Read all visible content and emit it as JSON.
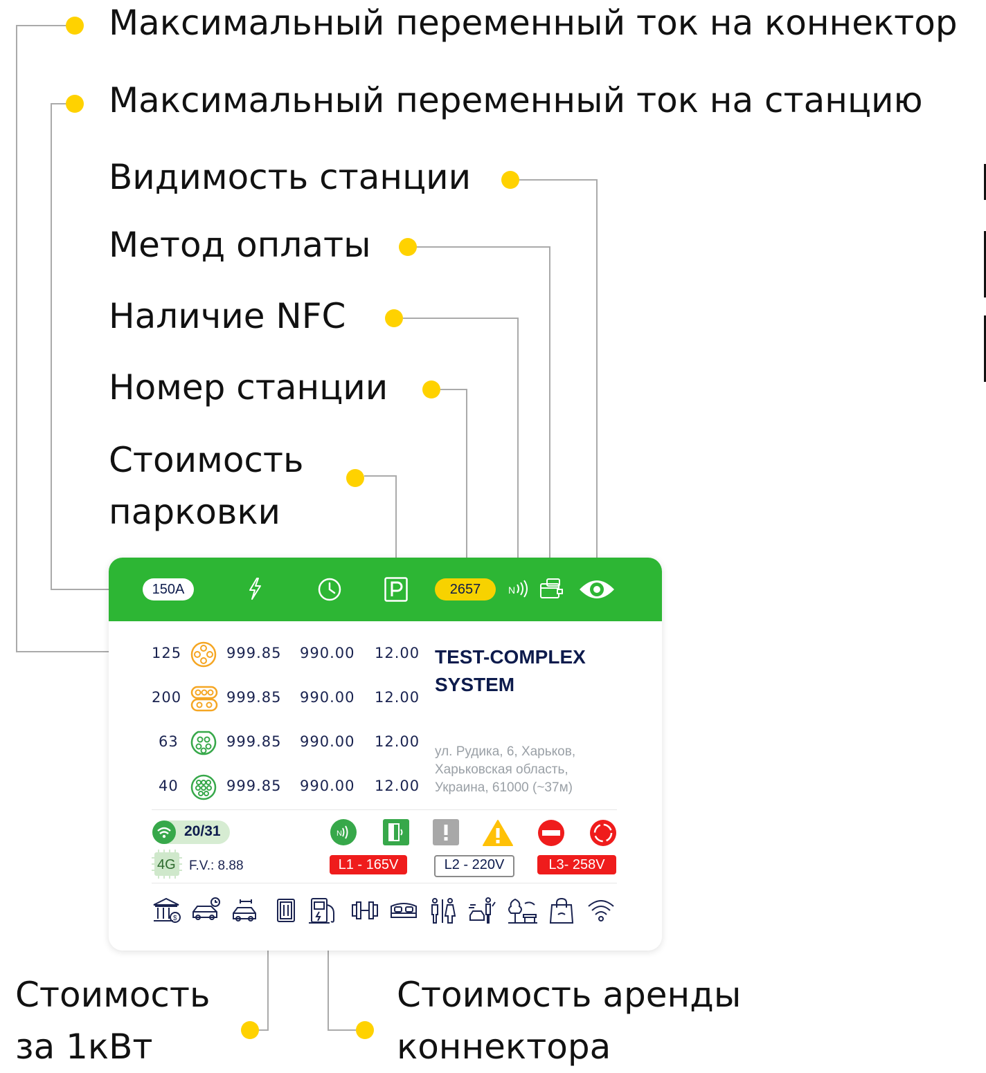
{
  "callouts": {
    "max_current_connector": "Максимальный переменный ток на коннектор",
    "max_current_station": "Максимальный переменный ток на станцию",
    "station_visibility": "Видимость станции",
    "payment_method": "Метод оплаты",
    "nfc_availability": "Наличие NFC",
    "station_number": "Номер станции",
    "parking_cost_line1": "Стоимость",
    "parking_cost_line2": "парковки",
    "cost_per_kwh_line1": "Стоимость",
    "cost_per_kwh_line2": "за 1кВт",
    "connector_rent_line1": "Стоимость аренды",
    "connector_rent_line2": "коннектора"
  },
  "card": {
    "header": {
      "max_current": "150A",
      "station_number": "2657",
      "icons": [
        "lightning-icon",
        "clock-icon",
        "parking-icon",
        "nfc-icon",
        "wallet-icon",
        "eye-icon"
      ]
    },
    "connectors": [
      {
        "current": "125",
        "icon": "connector-ccs-orange-icon",
        "price_kwh": "999.85",
        "rent": "990.00",
        "parking": "12.00"
      },
      {
        "current": "200",
        "icon": "connector-chademo-orange-icon",
        "price_kwh": "999.85",
        "rent": "990.00",
        "parking": "12.00"
      },
      {
        "current": "63",
        "icon": "connector-type2-green-icon",
        "price_kwh": "999.85",
        "rent": "990.00",
        "parking": "12.00"
      },
      {
        "current": "40",
        "icon": "connector-gbt-green-icon",
        "price_kwh": "999.85",
        "rent": "990.00",
        "parking": "12.00"
      }
    ],
    "station_name": "TEST-COMPLEX SYSTEM",
    "address": "ул. Рудика, 6, Харьков, Харьковская область, Украина, 61000 (~37м)",
    "signal": "20/31",
    "network": "4G",
    "firmware": "F.V.: 8.88",
    "phases": [
      "L1 - 165V",
      "L2 - 220V",
      "L3- 258V"
    ],
    "status_icons": [
      "nfc-status-icon",
      "door-status-icon",
      "alert-grey-icon",
      "warning-icon",
      "no-entry-icon",
      "error-ring-icon"
    ],
    "amenities": [
      "bank-icon",
      "car-wait-icon",
      "car-service-icon",
      "menu-icon",
      "fuel-station-icon",
      "gym-icon",
      "hotel-icon",
      "toilet-icon",
      "car-wash-icon",
      "park-icon",
      "shop-icon",
      "wifi-icon"
    ]
  },
  "colors": {
    "accent_green": "#2db634",
    "dot_yellow": "#ffd200",
    "alert_red": "#ef1c1c",
    "navy": "#0d1b4c",
    "orange": "#f5a623"
  }
}
